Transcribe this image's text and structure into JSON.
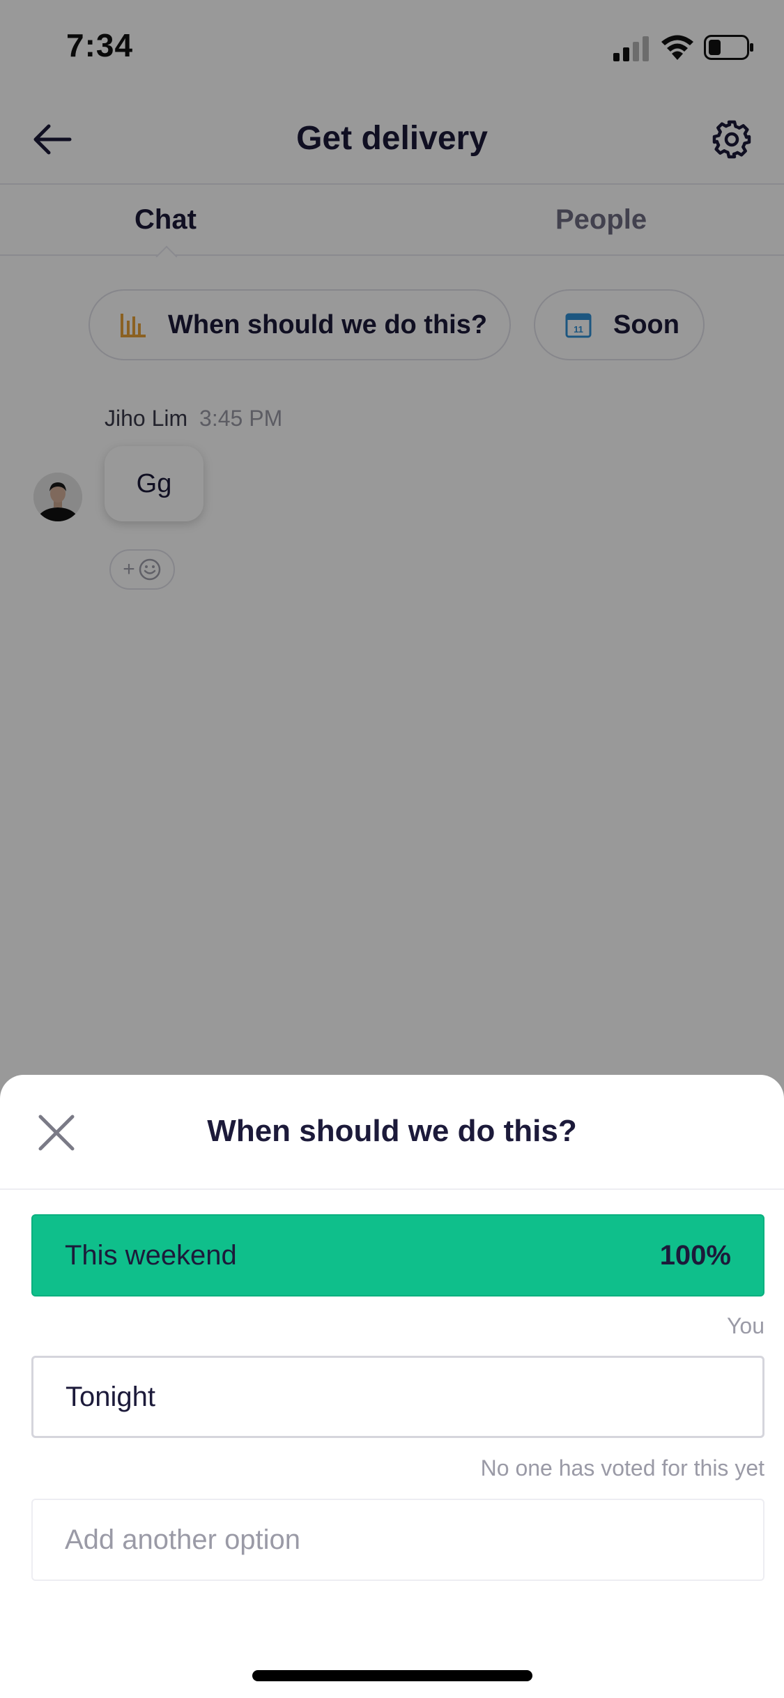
{
  "status_bar": {
    "time": "7:34"
  },
  "header": {
    "title": "Get delivery"
  },
  "tabs": [
    {
      "label": "Chat"
    },
    {
      "label": "People"
    }
  ],
  "chips": {
    "poll": {
      "label": "When should we do this?",
      "icon": "bar-chart-icon",
      "icon_color": "#e8a23a"
    },
    "date": {
      "label": "Soon",
      "icon": "calendar-icon",
      "icon_day": "11",
      "icon_color": "#2f8fd6"
    }
  },
  "message": {
    "author": "Jiho Lim",
    "time": "3:45 PM",
    "text": "Gg",
    "reaction_label": "+"
  },
  "sheet": {
    "title": "When should we do this?",
    "options": [
      {
        "label": "This weekend",
        "percent": "100%",
        "note": "You",
        "fill_fraction": 1.0,
        "color": "#0fbf8b"
      },
      {
        "label": "Tonight",
        "percent": "",
        "note": "No one has voted for this yet",
        "fill_fraction": 0.0
      }
    ],
    "add_placeholder": "Add another option"
  }
}
